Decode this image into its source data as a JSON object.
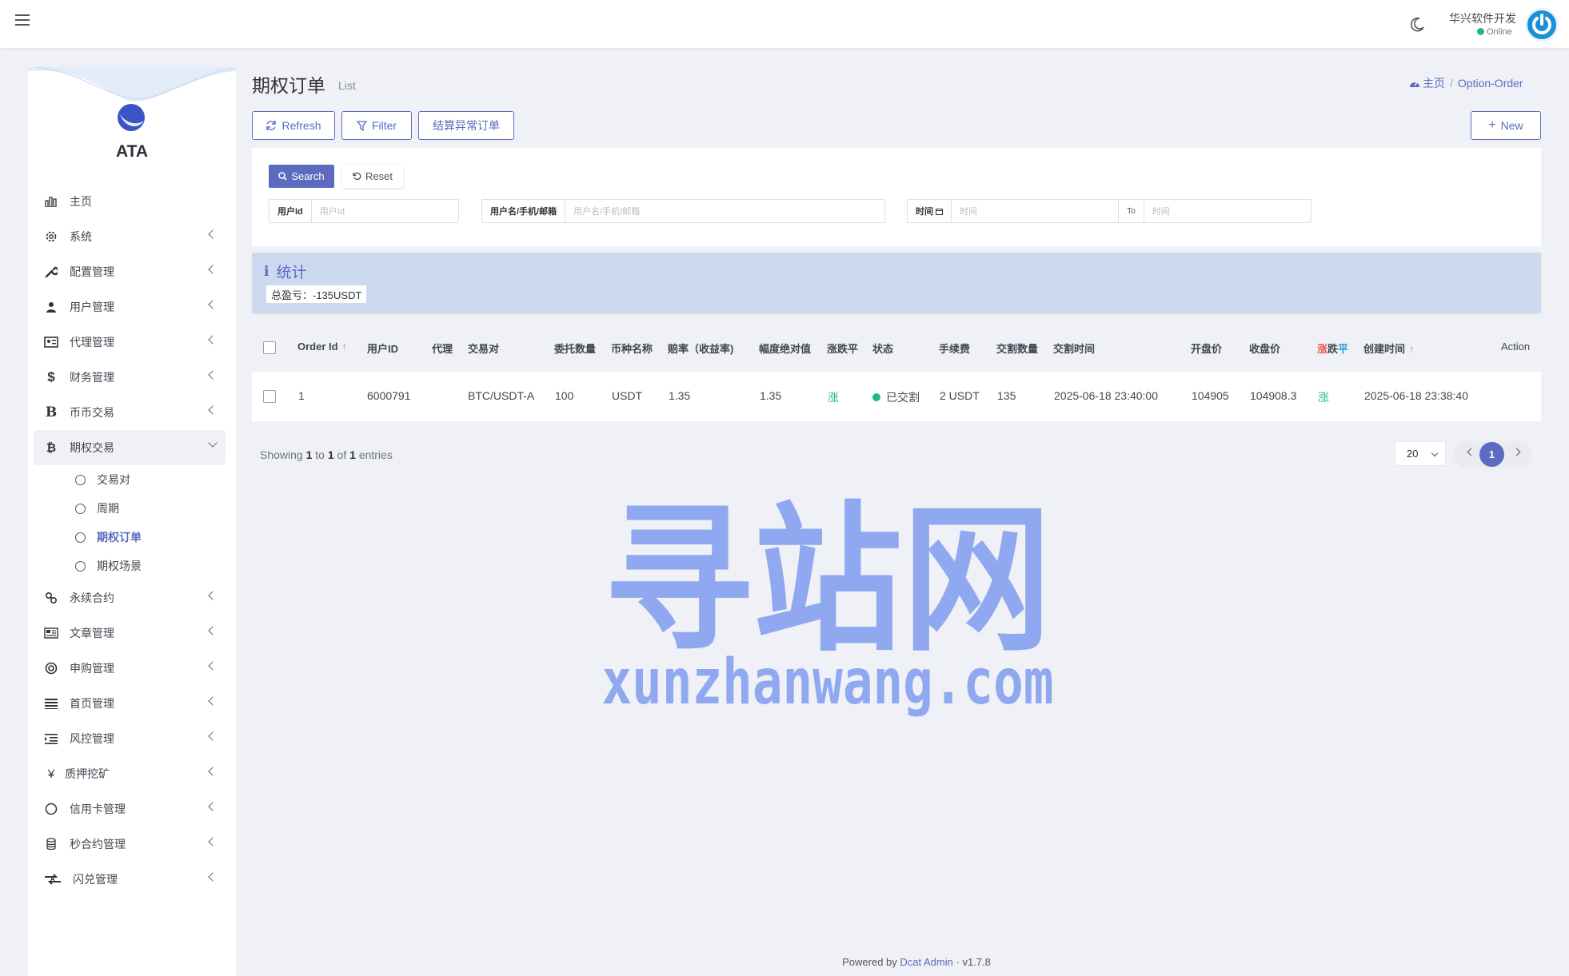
{
  "navbar": {
    "user_name": "华兴软件开发",
    "user_status": "Online"
  },
  "sidebar": {
    "logo_text": "ATA",
    "items": [
      {
        "label": "主页",
        "icon": "bar-chart-icon",
        "expandable": false
      },
      {
        "label": "系统",
        "icon": "gear-icon",
        "expandable": true
      },
      {
        "label": "配置管理",
        "icon": "wrench-icon",
        "expandable": true
      },
      {
        "label": "用户管理",
        "icon": "users-icon",
        "expandable": true
      },
      {
        "label": "代理管理",
        "icon": "id-card-icon",
        "expandable": true
      },
      {
        "label": "财务管理",
        "icon": "dollar-icon",
        "expandable": true
      },
      {
        "label": "币币交易",
        "icon": "bitcoin-b-icon",
        "expandable": true
      },
      {
        "label": "期权交易",
        "icon": "bitcoin-icon",
        "expandable": true,
        "open": true
      }
    ],
    "submenu": [
      {
        "label": "交易对"
      },
      {
        "label": "周期"
      },
      {
        "label": "期权订单",
        "current": true
      },
      {
        "label": "期权场景"
      }
    ],
    "items_after": [
      {
        "label": "永续合约",
        "icon": "link-icon"
      },
      {
        "label": "文章管理",
        "icon": "newspaper-icon"
      },
      {
        "label": "申购管理",
        "icon": "lifebuoy-icon"
      },
      {
        "label": "首页管理",
        "icon": "list-icon"
      },
      {
        "label": "风控管理",
        "icon": "indent-icon"
      },
      {
        "label": "质押挖矿",
        "icon": "yen-icon"
      },
      {
        "label": "信用卡管理",
        "icon": "circle-icon"
      },
      {
        "label": "秒合约管理",
        "icon": "coin-stack-icon"
      },
      {
        "label": "闪兑管理",
        "icon": "exchange-icon"
      }
    ]
  },
  "page": {
    "title": "期权订单",
    "subtitle": "List",
    "breadcrumb_home": "主页",
    "breadcrumb_current": "Option-Order"
  },
  "toolbar": {
    "refresh_label": "Refresh",
    "filter_label": "Filter",
    "settle_label": "结算异常订单",
    "new_label": "New"
  },
  "filter": {
    "search_label": "Search",
    "reset_label": "Reset",
    "user_id_label": "用户Id",
    "user_id_placeholder": "用户Id",
    "user_name_label": "用户名/手机/邮箱",
    "user_name_placeholder": "用户名/手机/邮箱",
    "time_label": "时间",
    "time_start_placeholder": "时间",
    "time_to_label": "To",
    "time_end_placeholder": "时间"
  },
  "stats": {
    "title": "统计",
    "total_label": "总盈亏：-135USDT"
  },
  "table": {
    "headers": {
      "order_id": "Order Id",
      "user_id": "用户ID",
      "agent": "代理",
      "pair": "交易对",
      "quantity": "委托数量",
      "currency": "币种名称",
      "odds": "赔率（收益率)",
      "amplitude": "幅度绝对值",
      "direction": "涨跌平",
      "status": "状态",
      "fee": "手续费",
      "delivery_qty": "交割数量",
      "delivery_time": "交割时间",
      "open_price": "开盘价",
      "close_price": "收盘价",
      "result_up": "涨",
      "result_down": "跌",
      "result_flat": "平",
      "created_at": "创建时间",
      "action": "Action"
    },
    "rows": [
      {
        "order_id": "1",
        "user_id": "6000791",
        "agent": "",
        "pair": "BTC/USDT-A",
        "quantity": "100",
        "currency": "USDT",
        "odds": "1.35",
        "amplitude": "1.35",
        "direction": "涨",
        "status": "已交割",
        "fee": "2 USDT",
        "delivery_qty": "135",
        "delivery_time": "2025-06-18 23:40:00",
        "open_price": "104905",
        "close_price": "104908.3",
        "result": "涨",
        "created_at": "2025-06-18 23:38:40"
      }
    ]
  },
  "pagination": {
    "showing_prefix": "Showing",
    "from": "1",
    "to_word": "to",
    "to": "1",
    "of_word": "of",
    "total": "1",
    "entries_word": "entries",
    "per_page": "20",
    "current_page": "1"
  },
  "watermark": {
    "line1": "寻站网",
    "line2": "xunzhanwang.com"
  },
  "footer": {
    "powered_by": "Powered by",
    "link_text": "Dcat Admin",
    "separator": "·",
    "version": "v1.7.8"
  },
  "colors": {
    "primary": "#5c6bc0",
    "success": "#21b978",
    "danger": "#ea5455",
    "stat_bg": "#cdd9ef",
    "watermark": "#8fa8f0"
  }
}
